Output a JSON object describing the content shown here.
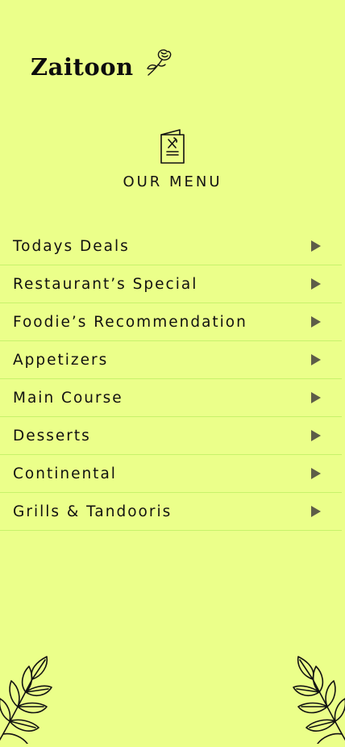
{
  "brand": {
    "name": "Zaitoon",
    "logo_icon": "rose-flower-icon"
  },
  "menu": {
    "icon": "menu-book-icon",
    "title": "OUR MENU",
    "items": [
      {
        "label": "Todays Deals",
        "icon": "triangle-right-icon"
      },
      {
        "label": "Restaurant’s Special",
        "icon": "triangle-right-icon"
      },
      {
        "label": "Foodie’s Recommendation",
        "icon": "triangle-right-icon"
      },
      {
        "label": "Appetizers",
        "icon": "triangle-right-icon"
      },
      {
        "label": "Main Course",
        "icon": "triangle-right-icon"
      },
      {
        "label": "Desserts",
        "icon": "triangle-right-icon"
      },
      {
        "label": "Continental",
        "icon": "triangle-right-icon"
      },
      {
        "label": "Grills & Tandooris",
        "icon": "triangle-right-icon"
      }
    ]
  },
  "colors": {
    "background": "#ebff8a",
    "divider": "#c7f26b",
    "arrow": "#5d5d48",
    "text": "#111111"
  },
  "decorations": [
    "olive-branch-left-icon",
    "olive-branch-right-icon"
  ]
}
